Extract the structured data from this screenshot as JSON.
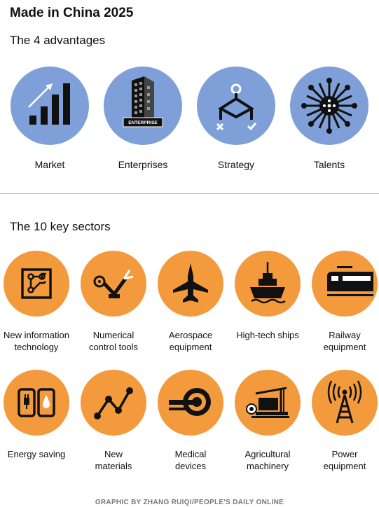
{
  "title": "Made in China 2025",
  "advantages_title": "The 4 advantages",
  "advantages": [
    {
      "label": "Market",
      "icon": "bar-chart-icon"
    },
    {
      "label": "Enterprises",
      "icon": "building-icon",
      "sign": "ENTERPRISE"
    },
    {
      "label": "Strategy",
      "icon": "strategy-flowchart-icon"
    },
    {
      "label": "Talents",
      "icon": "network-people-icon"
    }
  ],
  "sectors_title": "The 10 key sectors",
  "sectors": [
    {
      "line1": "New information",
      "line2": "technology",
      "icon": "circuit-board-icon"
    },
    {
      "line1": "Numerical",
      "line2": "control tools",
      "icon": "robot-arm-icon"
    },
    {
      "line1": "Aerospace",
      "line2": "equipment",
      "icon": "fighter-jet-icon"
    },
    {
      "line1": "High-tech ships",
      "line2": "",
      "icon": "ship-icon"
    },
    {
      "line1": "Railway",
      "line2": "equipment",
      "icon": "train-icon"
    },
    {
      "line1": "Energy saving",
      "line2": "",
      "icon": "plug-drop-icon"
    },
    {
      "line1": "New",
      "line2": "materials",
      "icon": "molecule-icon"
    },
    {
      "line1": "Medical",
      "line2": "devices",
      "icon": "mri-scanner-icon"
    },
    {
      "line1": "Agricultural",
      "line2": "machinery",
      "icon": "harvester-icon"
    },
    {
      "line1": "Power",
      "line2": "equipment",
      "icon": "power-tower-icon"
    }
  ],
  "credit": "GRAPHIC BY ZHANG RUIQI/PEOPLE'S DAILY ONLINE",
  "colors": {
    "advantage_circle": "#7e9fd7",
    "sector_circle": "#f39a3d",
    "icon": "#111111"
  }
}
